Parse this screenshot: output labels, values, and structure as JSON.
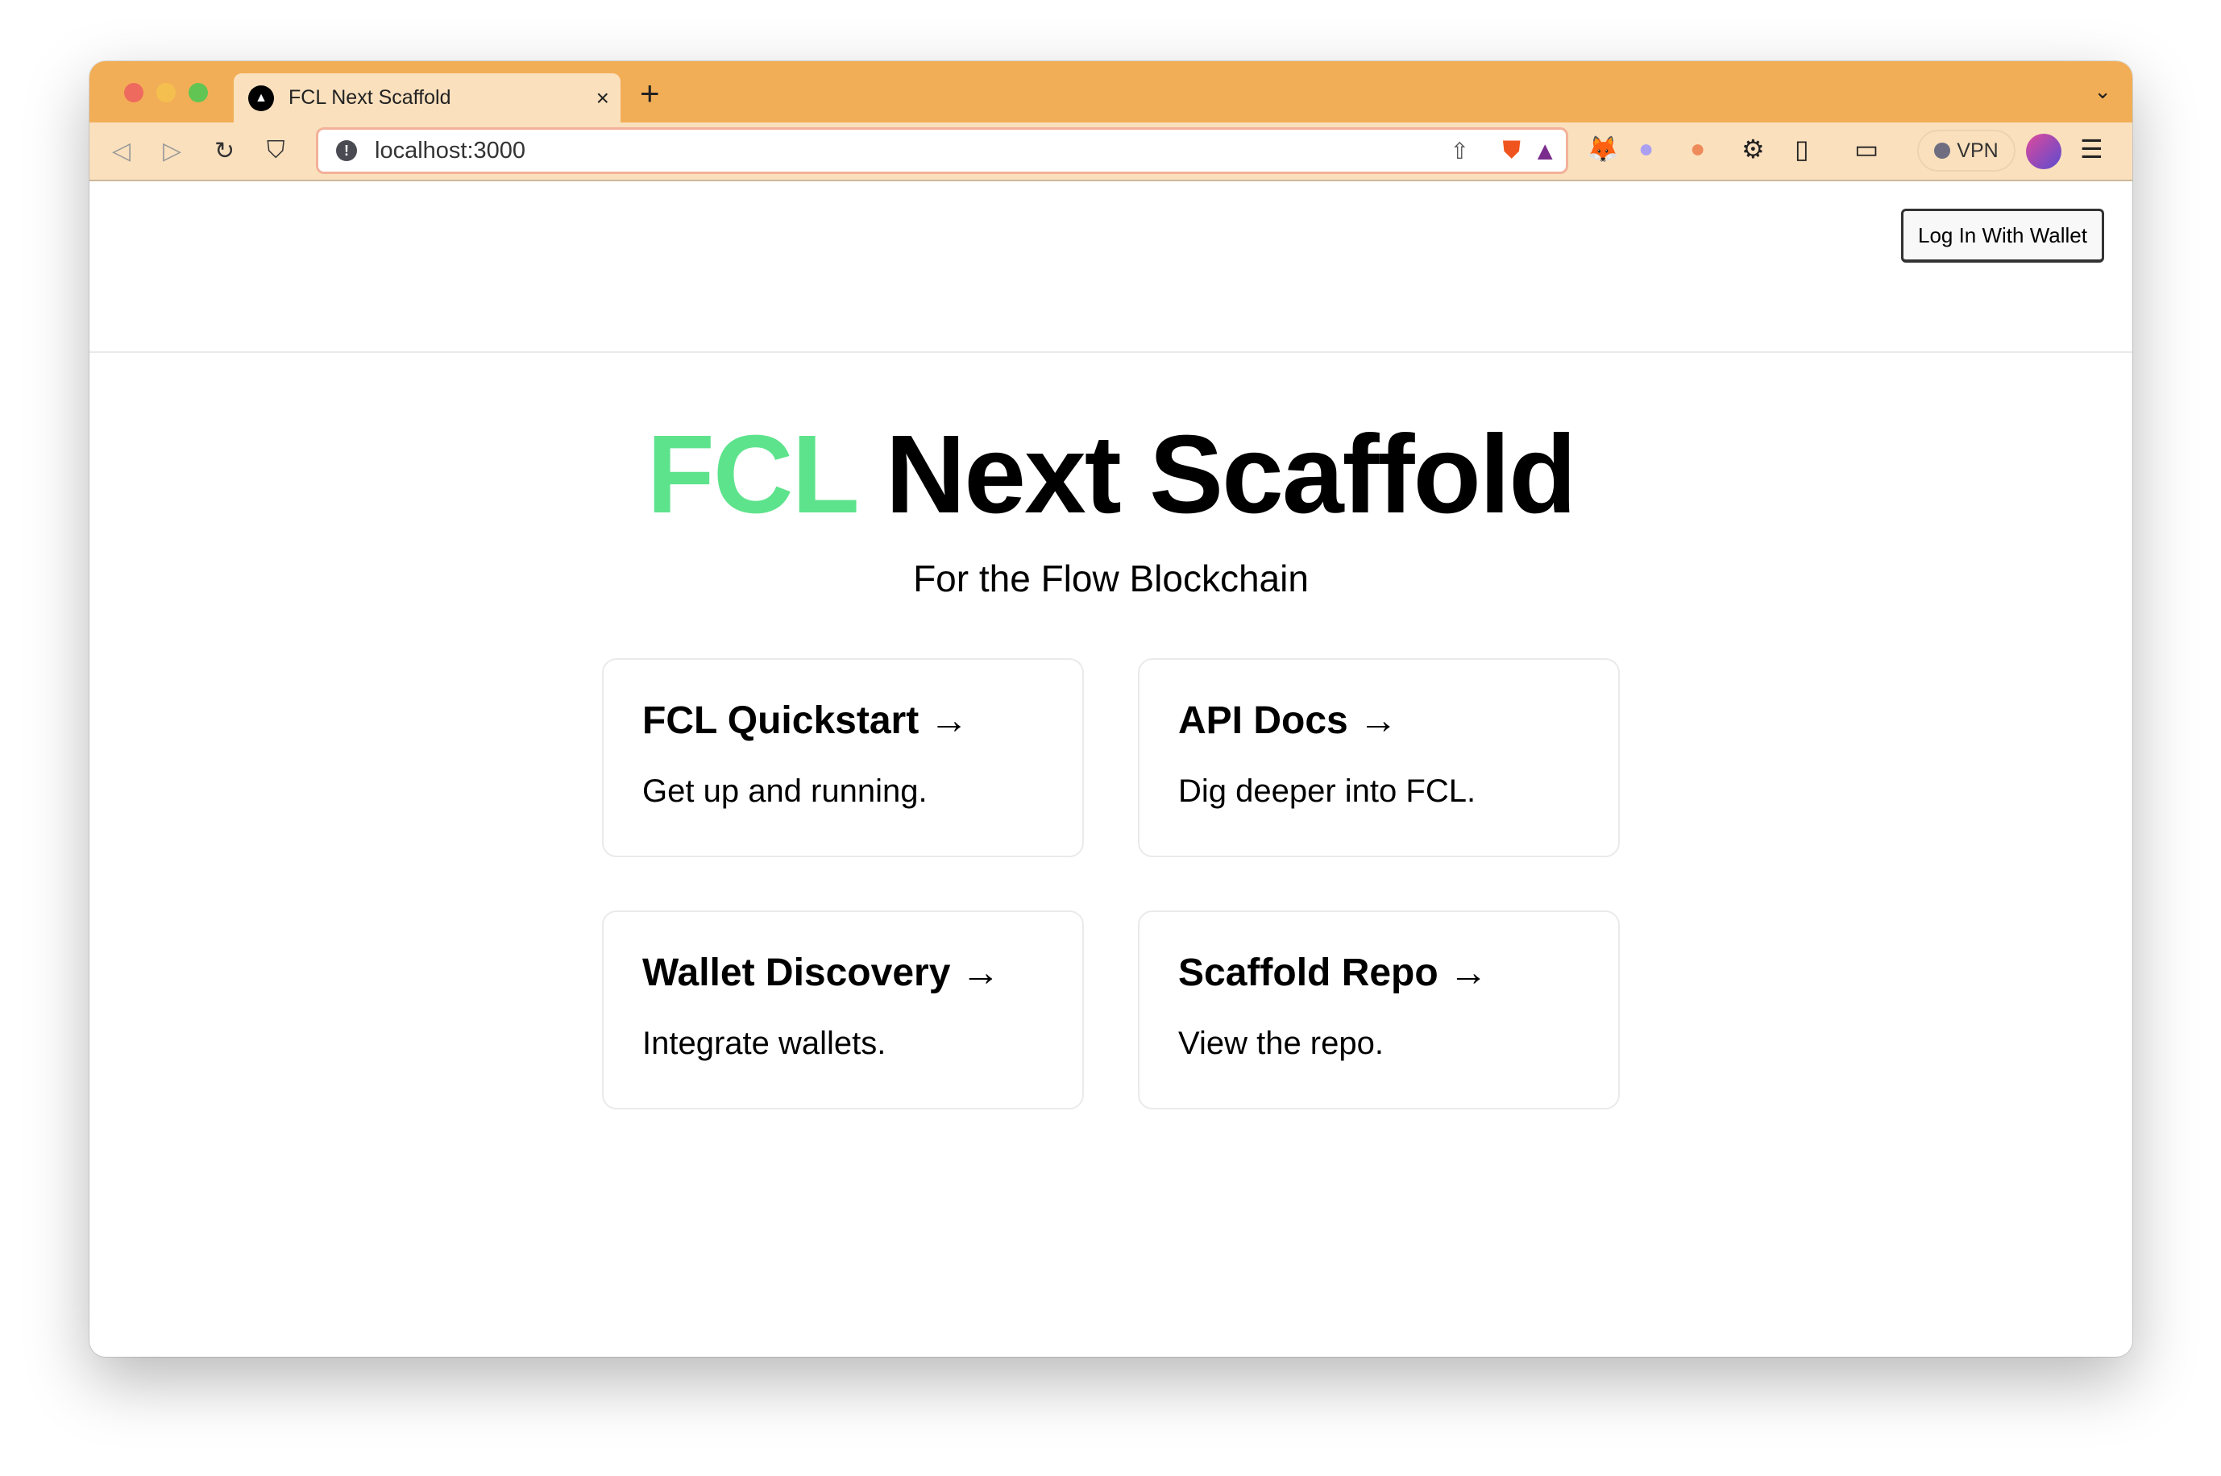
{
  "browser": {
    "tab_title": "FCL Next Scaffold",
    "url": "localhost:3000",
    "vpn_label": "VPN",
    "colors": {
      "tabbar": "#f2ae56",
      "toolbar": "#fae0bd"
    }
  },
  "header": {
    "login_label": "Log In With Wallet"
  },
  "hero": {
    "title_accent": "FCL",
    "title_rest": "Next Scaffold",
    "subtitle": "For the Flow Blockchain",
    "accent_color": "#5ee38d"
  },
  "cards": [
    {
      "title": "FCL Quickstart →",
      "desc": "Get up and running."
    },
    {
      "title": "API Docs →",
      "desc": "Dig deeper into FCL."
    },
    {
      "title": "Wallet Discovery →",
      "desc": "Integrate wallets."
    },
    {
      "title": "Scaffold Repo →",
      "desc": "View the repo."
    }
  ]
}
